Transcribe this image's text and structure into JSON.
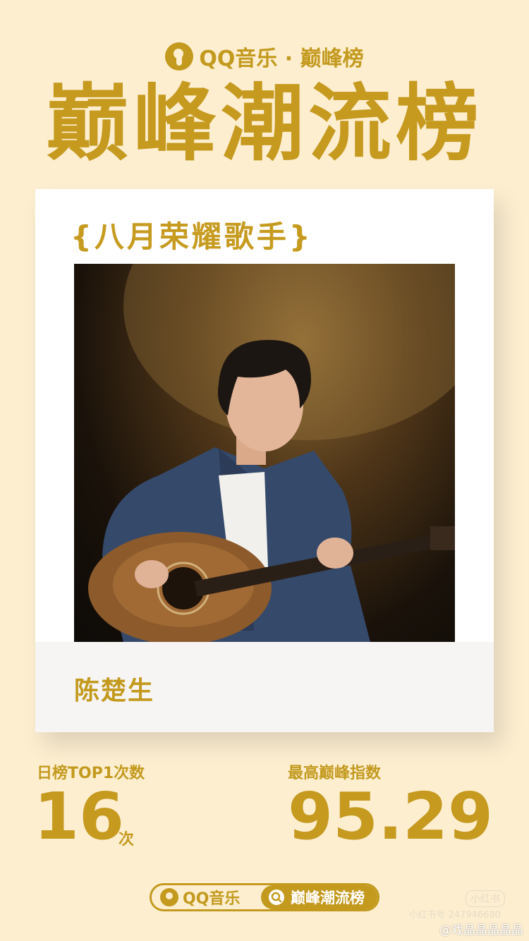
{
  "brand": {
    "logo_icon": "qq-music-note-icon",
    "text": "QQ音乐 · 巅峰榜"
  },
  "title": "巅峰潮流榜",
  "card": {
    "award": "{八月荣耀歌手}",
    "artist_name": "陈楚生"
  },
  "stats": {
    "left_label": "日榜TOP1次数",
    "left_value": "16",
    "left_unit": "次",
    "right_label": "最高巅峰指数",
    "right_value": "95.29"
  },
  "bottom_pill": {
    "left_text": "QQ音乐",
    "right_text": "巅峰潮流榜",
    "search_icon": "search-icon"
  },
  "watermarks": {
    "badge": "小红书",
    "id": "小红书号 247946680",
    "weibo": "@戏晶晶晶晶晶"
  },
  "colors": {
    "background": "#fdeed0",
    "gold": "#c59a1f",
    "card": "#ffffff",
    "card_footer": "#f6f5f3"
  }
}
